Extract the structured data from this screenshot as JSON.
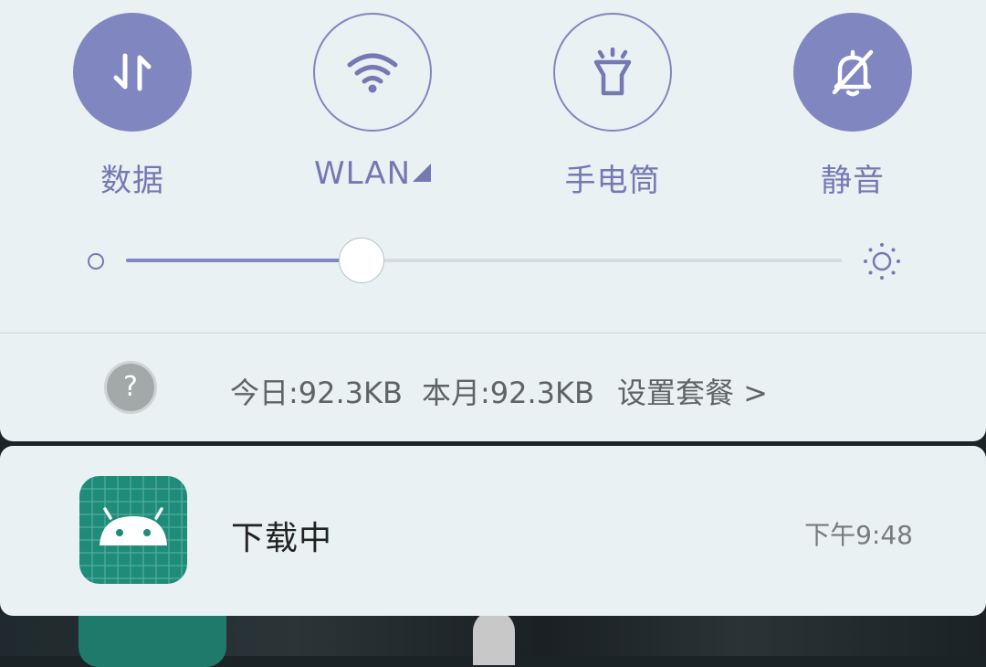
{
  "quick_settings": {
    "tiles": [
      {
        "label": "数据",
        "icon": "data-arrows-icon",
        "active": true
      },
      {
        "label": "WLAN",
        "icon": "wifi-icon",
        "active": false
      },
      {
        "label": "手电筒",
        "icon": "flashlight-icon",
        "active": false
      },
      {
        "label": "静音",
        "icon": "bell-off-icon",
        "active": true
      }
    ],
    "brightness": {
      "level_fraction": 0.33
    }
  },
  "data_usage": {
    "today": "今日:92.3KB",
    "month": "本月:92.3KB",
    "plan_link": "设置套餐 >"
  },
  "notification": {
    "title": "下载中",
    "time": "下午9:48"
  },
  "colors": {
    "accent": "#8086c0",
    "panel_bg": "#e9f1f3",
    "android_icon_bg": "#1f8b79"
  }
}
